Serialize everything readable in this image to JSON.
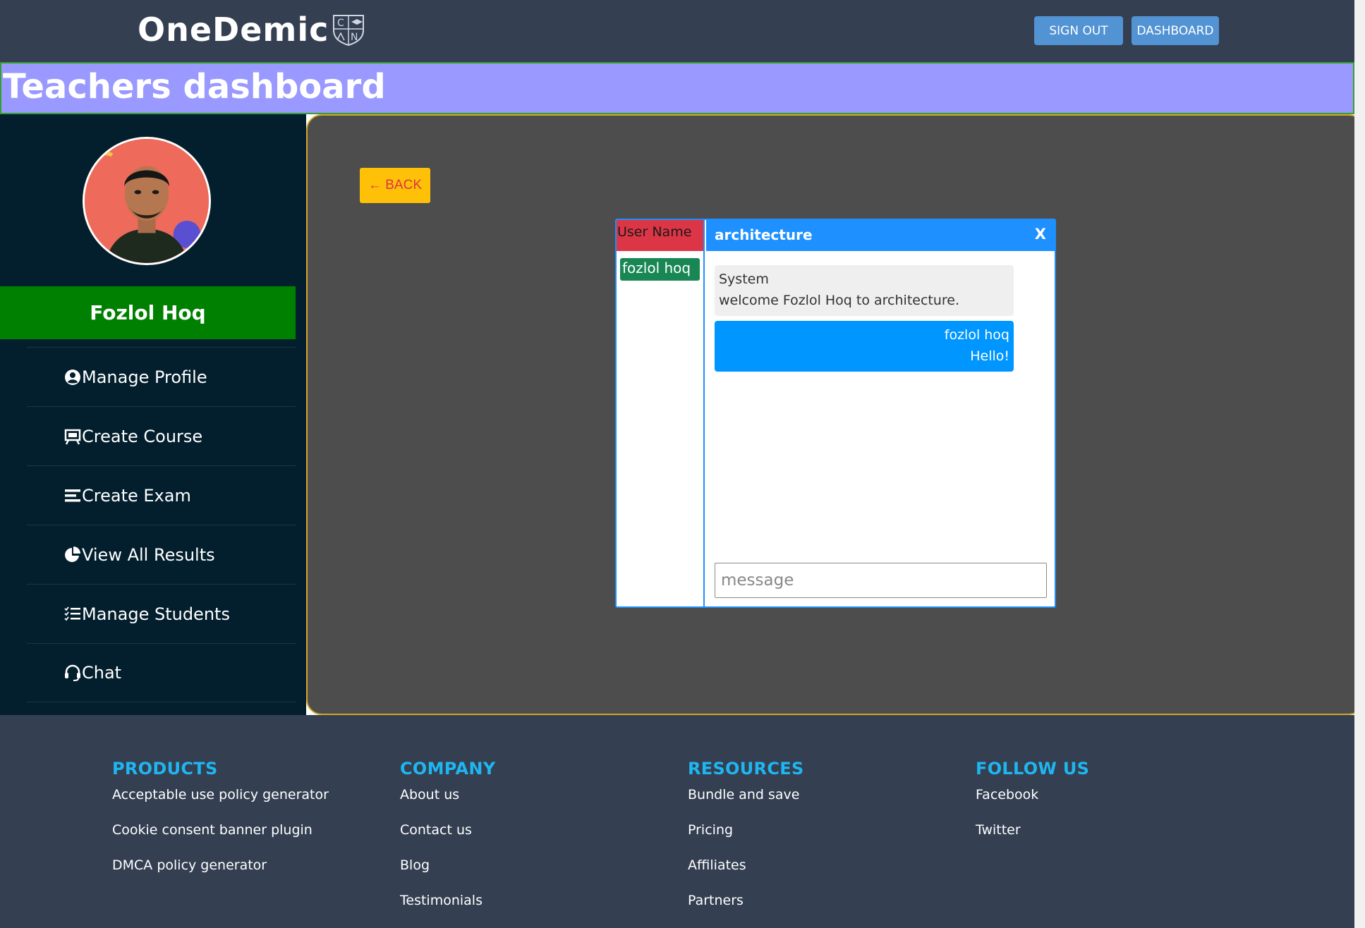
{
  "header": {
    "brand": "OneDemic",
    "sign_out": "SIGN OUT",
    "dashboard": "DASHBOARD"
  },
  "title": "Teachers dashboard",
  "sidebar": {
    "user_name": "Fozlol Hoq",
    "items": [
      {
        "label": "Manage Profile",
        "icon": "user-circle-icon"
      },
      {
        "label": "Create Course",
        "icon": "easel-icon"
      },
      {
        "label": "Create Exam",
        "icon": "bars-icon"
      },
      {
        "label": "View All Results",
        "icon": "pie-chart-icon"
      },
      {
        "label": "Manage Students",
        "icon": "list-check-icon"
      },
      {
        "label": "Chat",
        "icon": "headset-icon"
      }
    ]
  },
  "main": {
    "back_label": "← BACK",
    "chat": {
      "users_header": "User Name",
      "users": [
        "fozlol hoq"
      ],
      "room": "architecture",
      "close": "X",
      "messages": [
        {
          "sender": "System",
          "text": "welcome Fozlol Hoq to architecture."
        },
        {
          "sender": "fozlol hoq",
          "text": "Hello!"
        }
      ],
      "input_placeholder": "message"
    }
  },
  "footer": {
    "columns": [
      {
        "heading": "PRODUCTS",
        "links": [
          "Acceptable use policy generator",
          "Cookie consent banner plugin",
          "DMCA policy generator"
        ]
      },
      {
        "heading": "COMPANY",
        "links": [
          "About us",
          "Contact us",
          "Blog",
          "Testimonials"
        ]
      },
      {
        "heading": "RESOURCES",
        "links": [
          "Bundle and save",
          "Pricing",
          "Affiliates",
          "Partners"
        ]
      },
      {
        "heading": "FOLLOW US",
        "links": [
          "Facebook",
          "Twitter"
        ]
      }
    ]
  },
  "colors": {
    "nav_bg": "#343f52",
    "title_bg": "#9999ff",
    "sidebar_bg": "#031f2d",
    "name_bar": "#008000",
    "main_bg": "#4d4d4d",
    "chat_accent": "#1e90ff",
    "back_button": "#ffc107",
    "footer_heading": "#1fb6f0"
  }
}
